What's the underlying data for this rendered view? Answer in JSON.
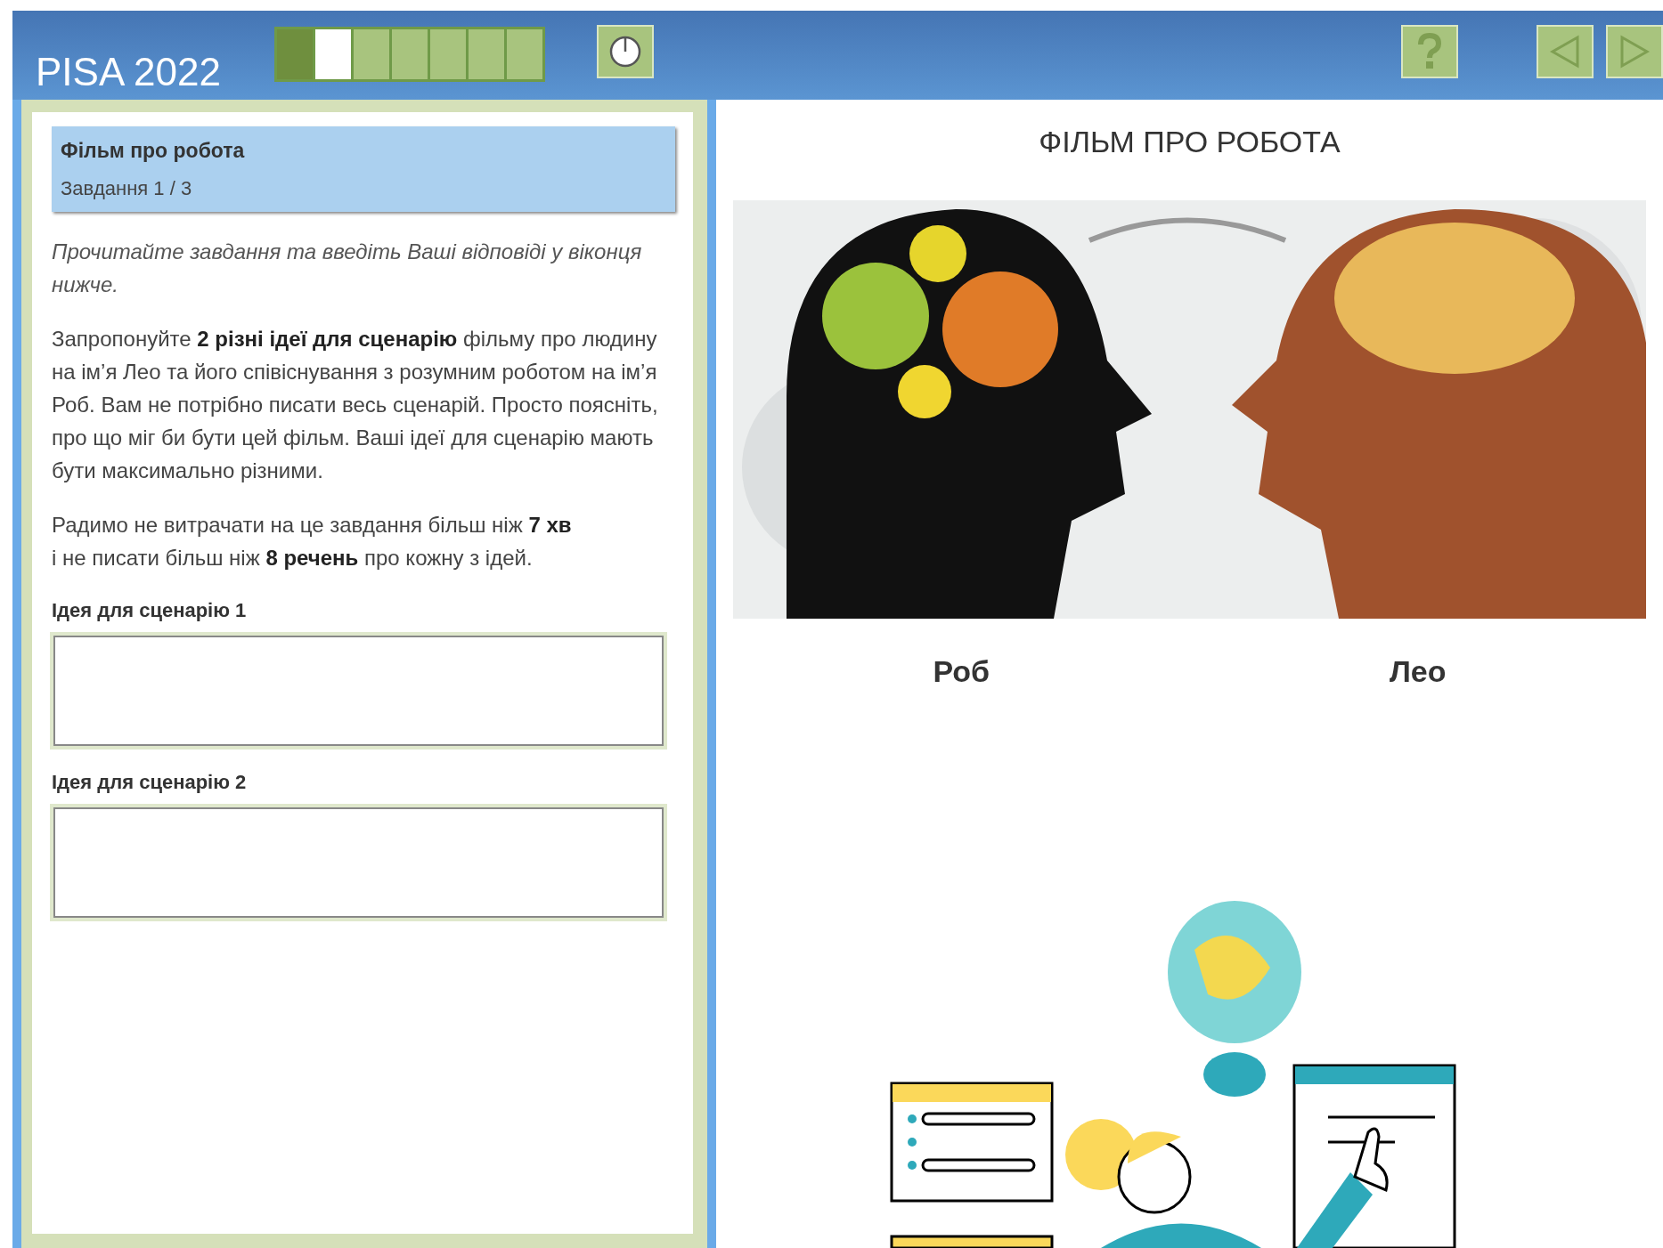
{
  "header": {
    "title": "PISA 2022",
    "progress": [
      {
        "completed": true,
        "selected": false
      },
      {
        "completed": false,
        "selected": true
      },
      {
        "completed": false,
        "selected": false
      },
      {
        "completed": false,
        "selected": false
      },
      {
        "completed": false,
        "selected": false
      },
      {
        "completed": false,
        "selected": false
      },
      {
        "completed": false,
        "selected": false
      }
    ]
  },
  "task": {
    "title": "Фільм про робота",
    "subtitle": "Завдання 1 / 3",
    "instruction": "Прочитайте завдання та введіть Ваші відповіді у віконця нижче.",
    "paragraphs": [
      [
        "Запропонуйте **2 різні ідеї для сценарію** фільму про людину на ім’я Лео та його співіснування з розумним роботом на ім’я Роб. Вам не потрібно писати весь сценарій. Просто поясніть, про що міг би бути цей фільм. Ваші ідеї для сценарію мають бути максимально різними."
      ],
      [
        "Радимо не витрачати на це завдання більш ніж **7 хв**",
        "і не писати більш ніж **8 речень** про кожну з ідей."
      ]
    ],
    "fields": [
      {
        "label": "Ідея для сценарію 1"
      },
      {
        "label": "Ідея для сценарію 2"
      }
    ]
  },
  "stimulus": {
    "title": "ФІЛЬМ ПРО РОБОТА",
    "captions": [
      "Роб",
      "Лео"
    ]
  }
}
